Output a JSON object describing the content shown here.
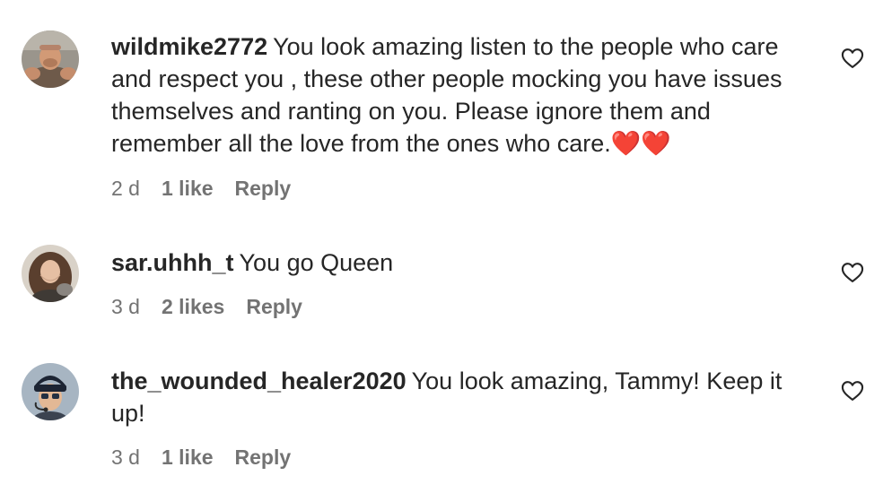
{
  "comments": [
    {
      "username": "wildmike2772",
      "text": "You look amazing listen to the people who care and respect you , these other people mocking you have issues themselves and ranting on you. Please ignore them and remember all the love from the ones who care.",
      "emoji": "❤️❤️",
      "time": "2 d",
      "likes": "1 like",
      "reply": "Reply",
      "avatar_icon": "avatar-photo-man"
    },
    {
      "username": "sar.uhhh_t",
      "text": "You go Queen",
      "time": "3 d",
      "likes": "2 likes",
      "reply": "Reply",
      "avatar_icon": "avatar-photo-woman"
    },
    {
      "username": "the_wounded_healer2020",
      "text": "You look amazing, Tammy! Keep it up!",
      "time": "3 d",
      "likes": "1 like",
      "reply": "Reply",
      "avatar_icon": "avatar-photo-cap"
    }
  ],
  "colors": {
    "text": "#262626",
    "meta": "#737373",
    "heart_emoji": "#e0262b",
    "like_icon_stroke": "#262626"
  }
}
